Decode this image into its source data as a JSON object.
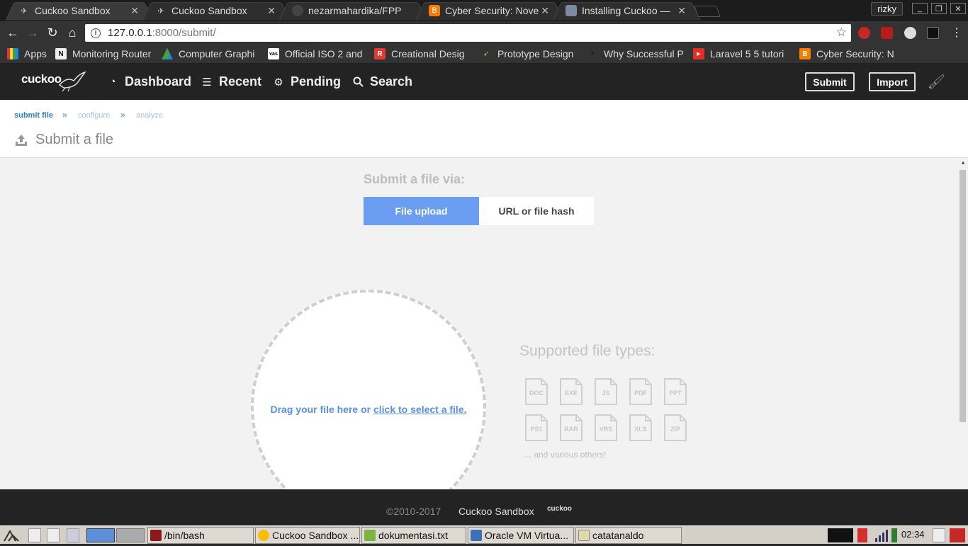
{
  "browser": {
    "tabs": [
      {
        "title": "Cuckoo Sandbox",
        "active": true
      },
      {
        "title": "Cuckoo Sandbox",
        "active": false
      },
      {
        "title": "nezarmahardika/FPP",
        "active": false
      },
      {
        "title": "Cyber Security: Nove",
        "active": false
      },
      {
        "title": "Installing Cuckoo —",
        "active": false
      }
    ],
    "profile": "rizky",
    "url_host": "127.0.0.1",
    "url_path": ":8000/submit/",
    "bookmarks": [
      "Apps",
      "Monitoring Router",
      "Computer Graphi",
      "Official ISO 2 and",
      "Creational Desig",
      "Prototype Design",
      "Why Successful P",
      "Laravel 5 5 tutori",
      "Cyber Security: N"
    ]
  },
  "navbar": {
    "logo": "cuckoo",
    "links": [
      "Dashboard",
      "Recent",
      "Pending",
      "Search"
    ],
    "submit_label": "Submit",
    "import_label": "Import"
  },
  "breadcrumb": {
    "step1": "submit file",
    "step2": "configure",
    "step3": "analyze",
    "sep": "»"
  },
  "page": {
    "title": "Submit a file",
    "via_title": "Submit a file via:",
    "seg_upload": "File upload",
    "seg_url": "URL or file hash",
    "drop_text": "Drag your file here or ",
    "drop_link": "click to select a file.",
    "types_title": "Supported file types:",
    "file_types": [
      "DOC",
      "EXE",
      "JS",
      "PDF",
      "PPT",
      "PS1",
      "RAR",
      "VBS",
      "XLS",
      "ZIP"
    ],
    "others": "... and various others!"
  },
  "footer": {
    "copyright": "©2010-2017",
    "name": "Cuckoo Sandbox",
    "logo": "cuckoo"
  },
  "taskbar": {
    "tasks": [
      "/bin/bash",
      "Cuckoo Sandbox ...",
      "dokumentasi.txt",
      "Oracle VM Virtua...",
      "catatanaldo"
    ],
    "clock": "02:34"
  },
  "colors": {
    "accent_blue": "#6b9ef0",
    "link_blue": "#5b8fe0",
    "navbar_bg": "#232323"
  }
}
